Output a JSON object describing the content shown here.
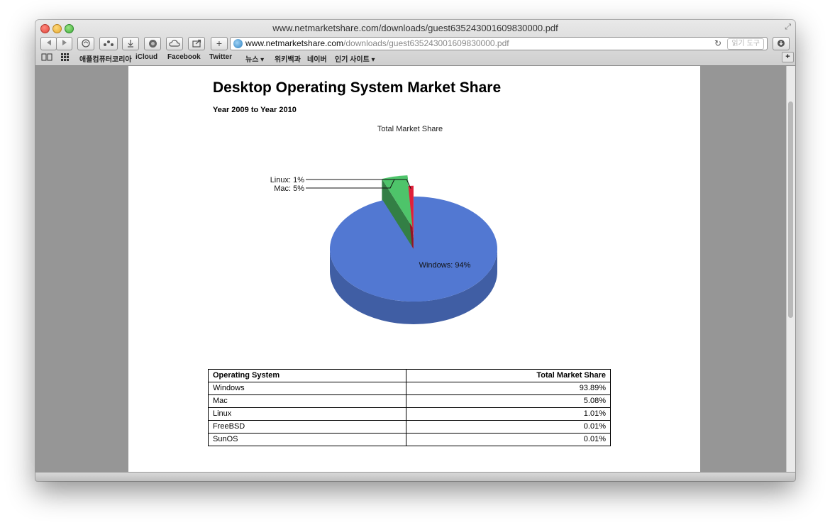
{
  "window": {
    "title": "www.netmarketshare.com/downloads/guest635243001609830000.pdf"
  },
  "toolbar": {
    "add_label": "+",
    "url_domain": "www.netmarketshare.com",
    "url_path": "/downloads/guest635243001609830000.pdf",
    "reload_icon": "reload-icon",
    "reader_label": "읽기 도구"
  },
  "bookmarks": {
    "items": [
      "애플컴퓨터코리아",
      "iCloud",
      "Facebook",
      "Twitter",
      "뉴스 ▾",
      "위키백과",
      "네이버",
      "인기 사이트 ▾"
    ],
    "add_label": "+"
  },
  "document": {
    "title": "Desktop Operating System Market Share",
    "subtitle": "Year 2009 to Year 2010",
    "table": {
      "headers": [
        "Operating System",
        "Total Market Share"
      ],
      "rows": [
        [
          "Windows",
          "93.89%"
        ],
        [
          "Mac",
          "5.08%"
        ],
        [
          "Linux",
          "1.01%"
        ],
        [
          "FreeBSD",
          "0.01%"
        ],
        [
          "SunOS",
          "0.01%"
        ]
      ]
    }
  },
  "chart_data": {
    "type": "pie",
    "title": "Total Market Share",
    "slices": [
      {
        "label": "Windows",
        "value": 94,
        "display": "Windows: 94%",
        "color": "#5278d2"
      },
      {
        "label": "Mac",
        "value": 5,
        "display": "Mac: 5%",
        "color": "#4ec46a"
      },
      {
        "label": "Linux",
        "value": 1,
        "display": "Linux: 1%",
        "color": "#e0203a"
      }
    ]
  }
}
